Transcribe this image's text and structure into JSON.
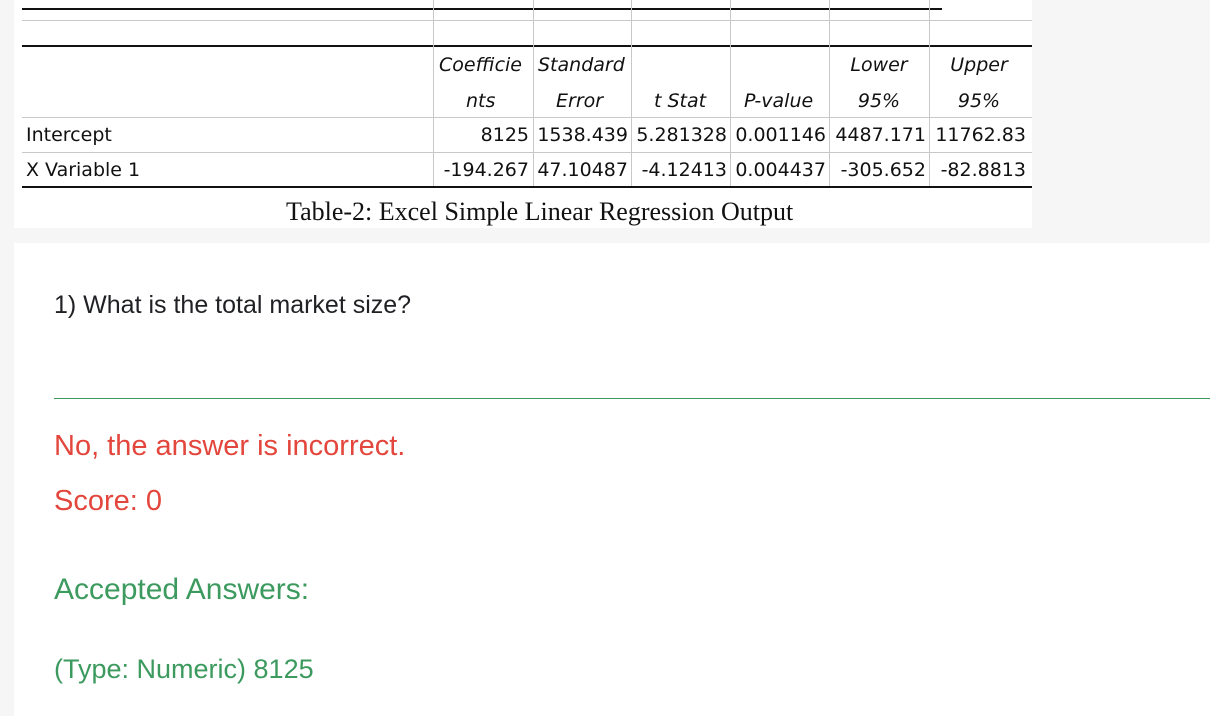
{
  "regression_table": {
    "headers": [
      {
        "line1": "Coefficie",
        "line2": "nts"
      },
      {
        "line1": "Standard",
        "line2": "Error"
      },
      {
        "line1": "",
        "line2": "t Stat"
      },
      {
        "line1": "",
        "line2": "P-value"
      },
      {
        "line1": "Lower",
        "line2": "95%"
      },
      {
        "line1": "Upper",
        "line2": "95%"
      }
    ],
    "rows": [
      {
        "label": "Intercept",
        "values": [
          "8125",
          "1538.439",
          "5.281328",
          "0.001146",
          "4487.171",
          "11762.83"
        ]
      },
      {
        "label": "X Variable 1",
        "values": [
          "-194.267",
          "47.10487",
          "-4.12413",
          "0.004437",
          "-305.652",
          "-82.8813"
        ]
      }
    ],
    "caption": "Table-2: Excel Simple Linear Regression Output"
  },
  "question": {
    "number_text": "1) What is the total market size?",
    "answer_value": "",
    "feedback": "No, the answer is incorrect.",
    "score": "Score: 0",
    "accepted_title": "Accepted Answers:",
    "accepted_value": "(Type: Numeric) 8125"
  },
  "colors": {
    "incorrect": "#e3463c",
    "accepted": "#3c9a5f"
  }
}
